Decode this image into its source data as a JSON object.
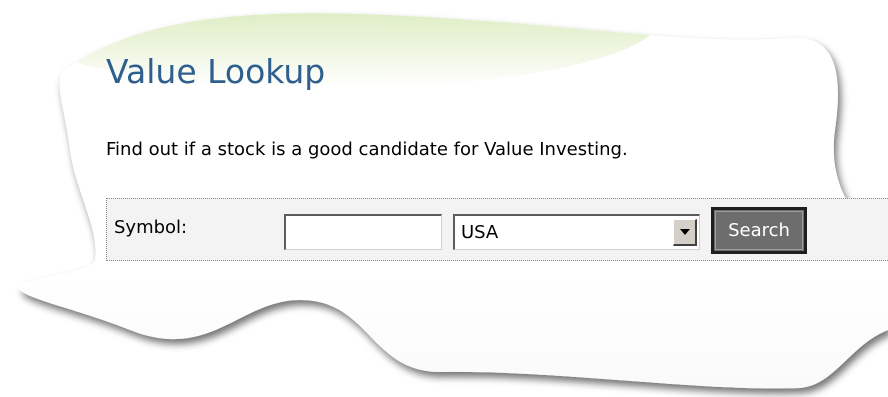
{
  "page": {
    "title": "Value Lookup",
    "description": "Find out if a stock is a good candidate for Value Investing."
  },
  "search_form": {
    "symbol_label": "Symbol:",
    "symbol_value": "",
    "symbol_placeholder": "",
    "country_selected": "USA",
    "search_button_label": "Search"
  },
  "colors": {
    "title": "#2f5f8f",
    "accent_green": "#a8cf5a",
    "search_button_bg": "#6d6d6d",
    "search_bar_bg": "#f3f3f3"
  },
  "icons": {
    "dropdown": "chevron-down-icon"
  }
}
